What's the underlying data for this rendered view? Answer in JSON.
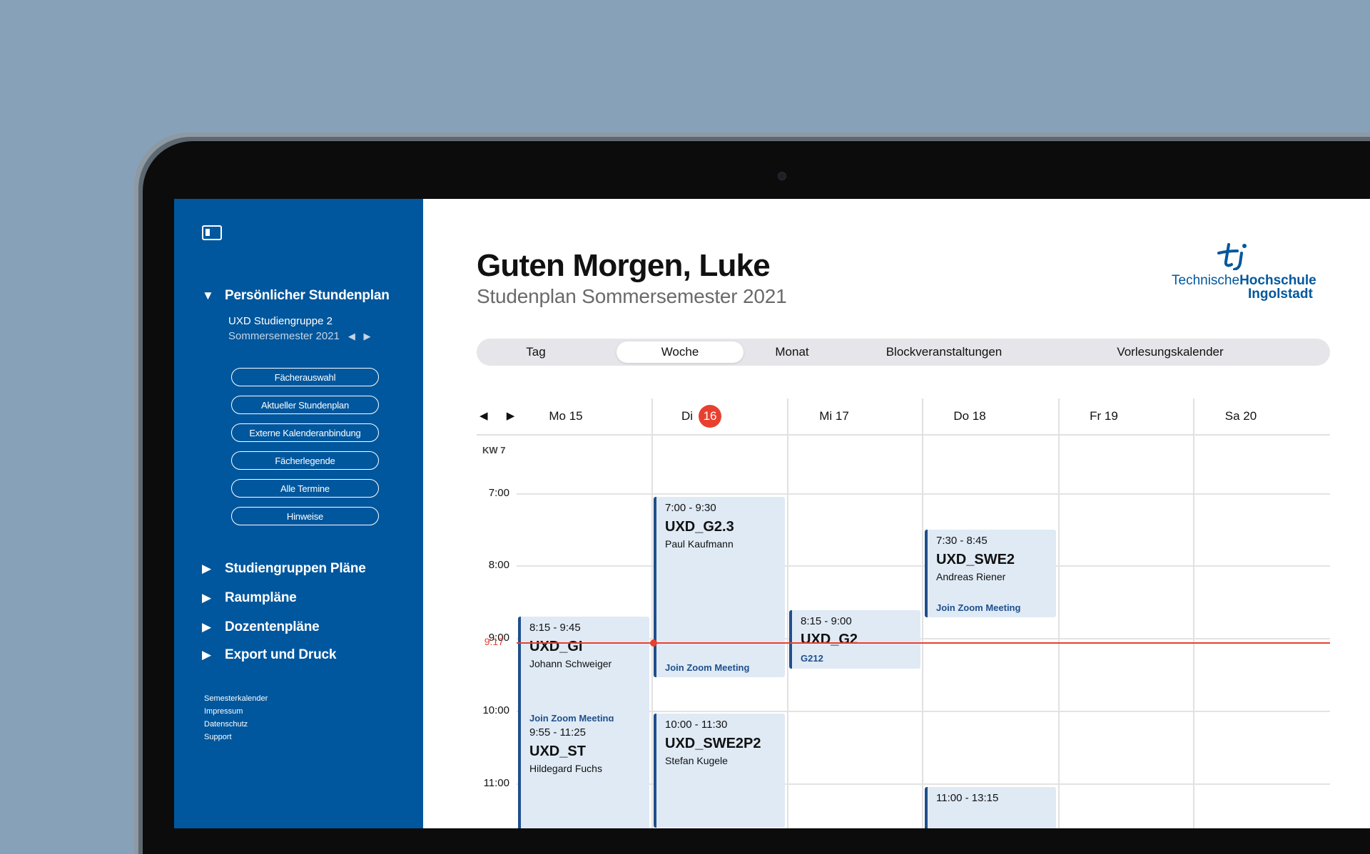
{
  "sidebar": {
    "toggle_icon": "sidebar-toggle-icon",
    "personal": {
      "label": "Persönlicher Stundenplan",
      "group": "UXD Studiengruppe 2",
      "semester": "Sommersemester 2021",
      "semester_arrows": "◀ ▶",
      "buttons": [
        "Fächerauswahl",
        "Aktueller Stundenplan",
        "Externe Kalenderanbindung",
        "Fächerlegende",
        "Alle Termine",
        "Hinweise"
      ]
    },
    "sections": [
      "Studiengruppen Pläne",
      "Raumpläne",
      "Dozentenpläne",
      "Export und Druck"
    ],
    "footer": [
      "Semesterkalender",
      "Impressum",
      "Datenschutz",
      "Support"
    ]
  },
  "header": {
    "greeting": "Guten Morgen, Luke",
    "subtitle": "Studenplan Sommersemester 2021",
    "logo_text_1": "Technische",
    "logo_text_2": "Hochschule",
    "logo_text_3": "Ingolstadt"
  },
  "views": {
    "tabs": [
      "Tag",
      "Woche",
      "Monat",
      "Blockveranstaltungen",
      "Vorlesungskalender"
    ],
    "active": "Woche"
  },
  "calendar": {
    "nav_arrows": "◀ ▶",
    "week_label": "KW 7",
    "days": [
      {
        "label": "Mo 15"
      },
      {
        "label": "Di",
        "badge": "16"
      },
      {
        "label": "Mi 17"
      },
      {
        "label": "Do 18"
      },
      {
        "label": "Fr 19"
      },
      {
        "label": "Sa 20"
      }
    ],
    "hours": [
      "7:00",
      "8:00",
      "9:00",
      "10:00",
      "11:00"
    ],
    "now_label": "9:17",
    "colors": {
      "accent": "#00579d",
      "event_bg": "#dfeaf5",
      "event_border": "#1f4f8c",
      "now": "#e8402f"
    },
    "events": [
      {
        "day": 0,
        "start": "8:15",
        "end": "9:45",
        "time": "8:15 - 9:45",
        "title": "UXD_GI",
        "person": "Johann Schweiger",
        "zoom": "Join Zoom Meeting"
      },
      {
        "day": 0,
        "start": "9:55",
        "end": "11:25",
        "time": "9:55 - 11:25",
        "title": "UXD_ST",
        "person": "Hildegard Fuchs"
      },
      {
        "day": 1,
        "start": "7:00",
        "end": "9:30",
        "time": "7:00 - 9:30",
        "title": "UXD_G2.3",
        "person": "Paul Kaufmann",
        "zoom": "Join Zoom Meeting"
      },
      {
        "day": 1,
        "start": "10:00",
        "end": "11:30",
        "time": "10:00 - 11:30",
        "title": "UXD_SWE2P2",
        "person": "Stefan Kugele"
      },
      {
        "day": 2,
        "start": "8:15",
        "end": "9:00",
        "time": "8:15 - 9:00",
        "title": "UXD_G2",
        "room": "G212"
      },
      {
        "day": 3,
        "start": "7:30",
        "end": "8:45",
        "time": "7:30 - 8:45",
        "title": "UXD_SWE2",
        "person": "Andreas Riener",
        "zoom": "Join Zoom Meeting"
      },
      {
        "day": 3,
        "start": "11:00",
        "end": "13:15",
        "time": "11:00 - 13:15"
      }
    ]
  }
}
